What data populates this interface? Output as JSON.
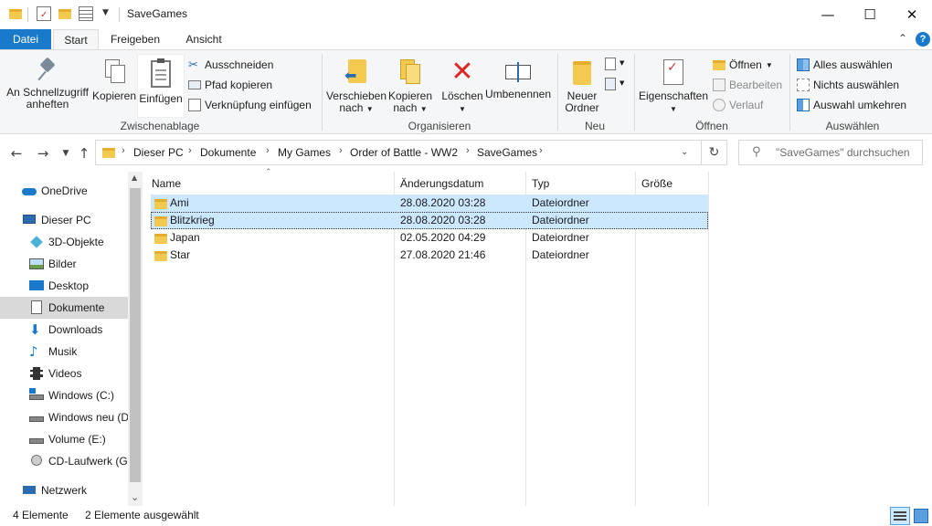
{
  "window": {
    "title": "SaveGames",
    "minimize": "—",
    "maximize": "☐",
    "close": "✕"
  },
  "tabs": [
    {
      "label": "Datei"
    },
    {
      "label": "Start"
    },
    {
      "label": "Freigeben"
    },
    {
      "label": "Ansicht"
    }
  ],
  "ribbon": {
    "pin_label": "An Schnellzugriff anheften",
    "copy_label": "Kopieren",
    "paste_label": "Einfügen",
    "cut_label": "Ausschneiden",
    "copy_path_label": "Pfad kopieren",
    "paste_shortcut_label": "Verknüpfung einfügen",
    "group_clipboard": "Zwischenablage",
    "move_label": "Verschieben nach",
    "copy_to_label": "Kopieren nach",
    "delete_label": "Löschen",
    "rename_label": "Umbenennen",
    "group_organize": "Organisieren",
    "new_folder_label": "Neuer Ordner",
    "group_new": "Neu",
    "properties_label": "Eigenschaften",
    "open_label": "Öffnen",
    "edit_label": "Bearbeiten",
    "history_label": "Verlauf",
    "group_open": "Öffnen",
    "select_all_label": "Alles auswählen",
    "select_none_label": "Nichts auswählen",
    "invert_selection_label": "Auswahl umkehren",
    "group_select": "Auswählen"
  },
  "breadcrumb": [
    "Dieser PC",
    "Dokumente",
    "My Games",
    "Order of Battle - WW2",
    "SaveGames"
  ],
  "search": {
    "placeholder": "\"SaveGames\" durchsuchen"
  },
  "sidebar": {
    "items": [
      {
        "label": "OneDrive"
      },
      {
        "label": "Dieser PC"
      },
      {
        "label": "3D-Objekte"
      },
      {
        "label": "Bilder"
      },
      {
        "label": "Desktop"
      },
      {
        "label": "Dokumente"
      },
      {
        "label": "Downloads"
      },
      {
        "label": "Musik"
      },
      {
        "label": "Videos"
      },
      {
        "label": "Windows (C:)"
      },
      {
        "label": "Windows neu (D:)"
      },
      {
        "label": "Volume (E:)"
      },
      {
        "label": "CD-Laufwerk (G:)"
      },
      {
        "label": "Netzwerk"
      }
    ]
  },
  "columns": {
    "name": "Name",
    "date": "Änderungsdatum",
    "type": "Typ",
    "size": "Größe"
  },
  "files": [
    {
      "name": "Ami",
      "date": "28.08.2020 03:28",
      "type": "Dateiordner",
      "size": ""
    },
    {
      "name": "Blitzkrieg",
      "date": "28.08.2020 03:28",
      "type": "Dateiordner",
      "size": ""
    },
    {
      "name": "Japan",
      "date": "02.05.2020 04:29",
      "type": "Dateiordner",
      "size": ""
    },
    {
      "name": "Star",
      "date": "27.08.2020 21:46",
      "type": "Dateiordner",
      "size": ""
    }
  ],
  "status": {
    "count": "4 Elemente",
    "selected": "2 Elemente ausgewählt"
  },
  "colors": {
    "accent": "#1979ca",
    "selection": "#cce8ff",
    "folder": "#f4c94f"
  }
}
